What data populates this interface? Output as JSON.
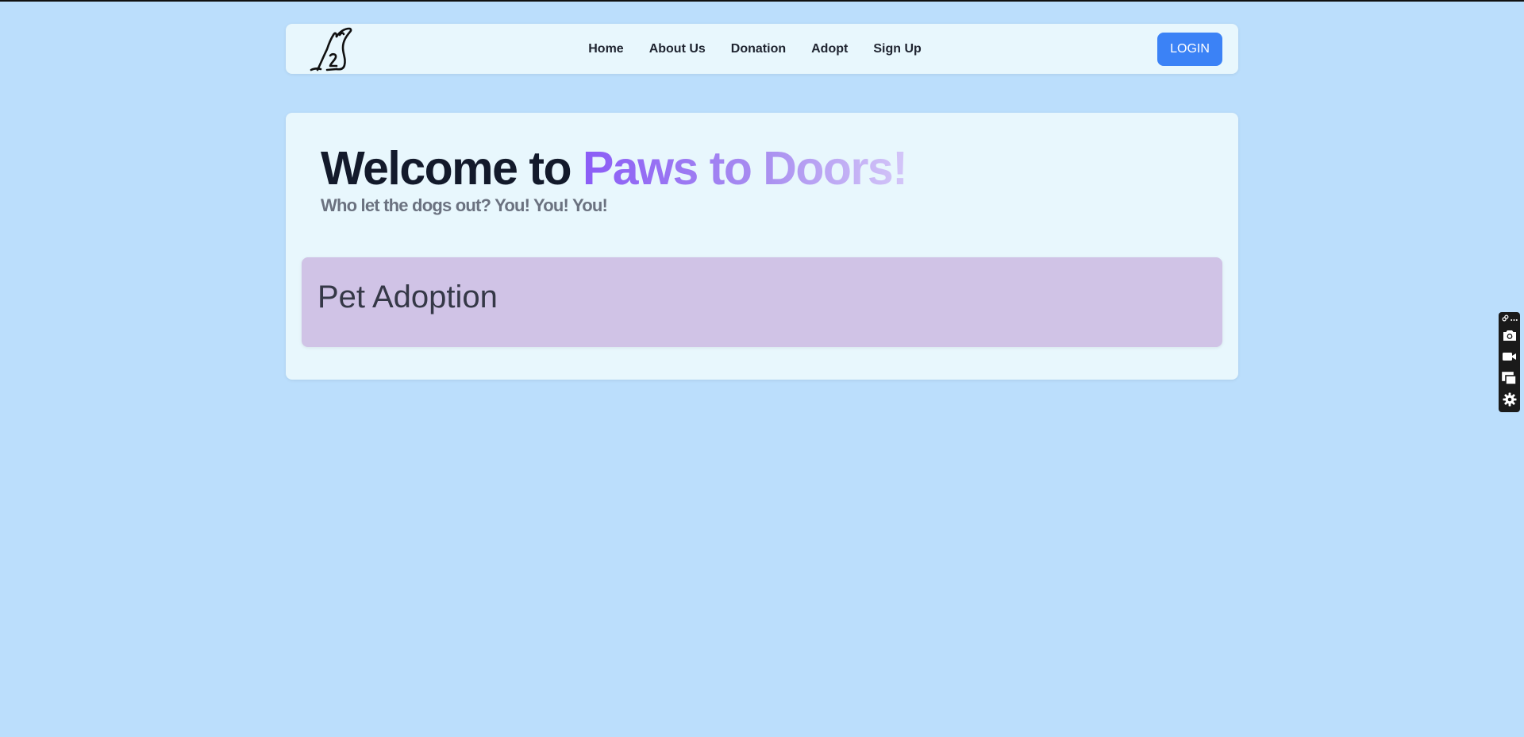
{
  "nav": {
    "logo_icon": "dog-logo-icon",
    "links": [
      "Home",
      "About Us",
      "Donation",
      "Adopt",
      "Sign Up"
    ],
    "login_label": "LOGIN"
  },
  "hero": {
    "title_prefix": "Welcome to ",
    "title_brand": "Paws to Doors!",
    "subtitle": "Who let the dogs out? You! You! You!"
  },
  "section": {
    "title": "Pet Adoption"
  },
  "extension_toolbar": {
    "icons": [
      "link-icon",
      "more-icon",
      "camera-icon",
      "video-icon",
      "windows-icon",
      "gear-icon"
    ]
  },
  "colors": {
    "page_background": "#bbdefc",
    "card_background": "#e8f7fd",
    "section_background": "#d0c3e6",
    "login_button": "#3b82f6",
    "brand_gradient_start": "#8b5cf6",
    "brand_gradient_end": "#d4c6f8"
  }
}
